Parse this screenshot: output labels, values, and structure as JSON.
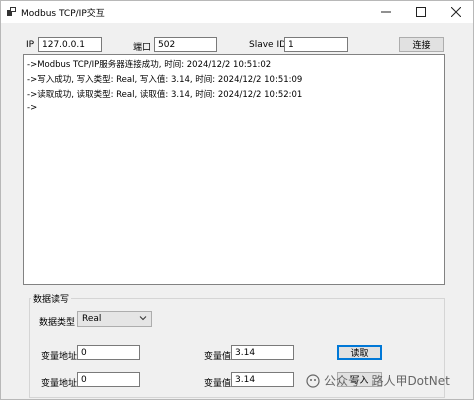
{
  "window": {
    "title": "Modbus TCP/IP交互"
  },
  "connection": {
    "ip_label": "IP",
    "ip_value": "127.0.0.1",
    "port_label": "端口",
    "port_value": "502",
    "slave_label": "Slave ID",
    "slave_value": "1",
    "connect_label": "连接"
  },
  "log": {
    "lines": [
      "->Modbus TCP/IP服务器连接成功, 时间: 2024/12/2 10:51:02",
      "->写入成功, 写入类型: Real, 写入值: 3.14, 时间: 2024/12/2 10:51:09",
      "->读取成功, 读取类型: Real, 读取值: 3.14, 时间: 2024/12/2 10:52:01",
      "->"
    ]
  },
  "rw": {
    "group_title": "数据读写",
    "type_label": "数据类型",
    "type_value": "Real",
    "read_addr_label": "变量地址",
    "read_addr_value": "0",
    "read_val_label": "变量值",
    "read_val_value": "3.14",
    "read_button": "读取",
    "write_addr_label": "变量地址",
    "write_addr_value": "0",
    "write_val_label": "变量值",
    "write_val_value": "3.14",
    "write_button": "写入"
  },
  "watermark": {
    "text": "公众号 · 路人甲DotNet"
  },
  "colors": {
    "window_bg": "#f0f0f0",
    "focus_border": "#0078d7"
  }
}
